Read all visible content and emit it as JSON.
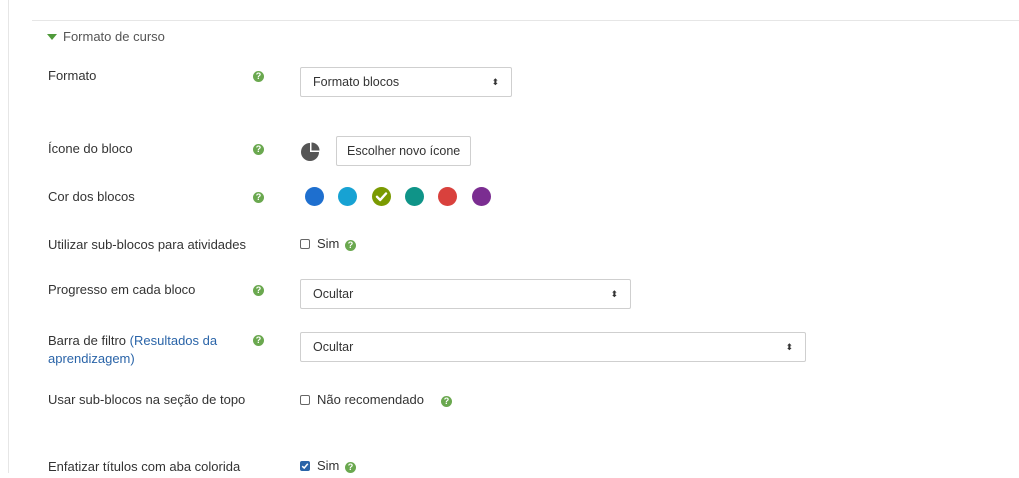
{
  "section": {
    "legend": "Formato de curso"
  },
  "fields": {
    "formato": {
      "label": "Formato",
      "value": "Formato blocos"
    },
    "icone": {
      "label": "Ícone do bloco",
      "button": "Escolher novo ícone"
    },
    "cor": {
      "label": "Cor dos blocos",
      "colors": [
        "#1e6fcf",
        "#17a2d3",
        "#7a9a01",
        "#0f9488",
        "#d9413d",
        "#7b2d91"
      ],
      "selected_index": 2
    },
    "subblocos": {
      "label": "Utilizar sub-blocos para atividades",
      "option": "Sim",
      "checked": false
    },
    "progresso": {
      "label": "Progresso em cada bloco",
      "value": "Ocultar"
    },
    "barra_filtro": {
      "label_prefix": "Barra de filtro ",
      "label_link": "(Resultados da aprendizagem)",
      "value": "Ocultar"
    },
    "subblocos_topo": {
      "label": "Usar sub-blocos na seção de topo",
      "option": "Não recomendado",
      "checked": false
    },
    "enfatizar": {
      "label": "Enfatizar títulos com aba colorida",
      "option": "Sim",
      "checked": true
    }
  },
  "icons": {
    "help": "question-circle-icon",
    "section_toggle": "caret-down-icon",
    "block_icon_preview": "pie-chart-icon",
    "select_arrows": "up-down-arrows-icon",
    "selected_swatch": "check-icon"
  },
  "help_glyph": "?",
  "select_glyph": "⬍"
}
